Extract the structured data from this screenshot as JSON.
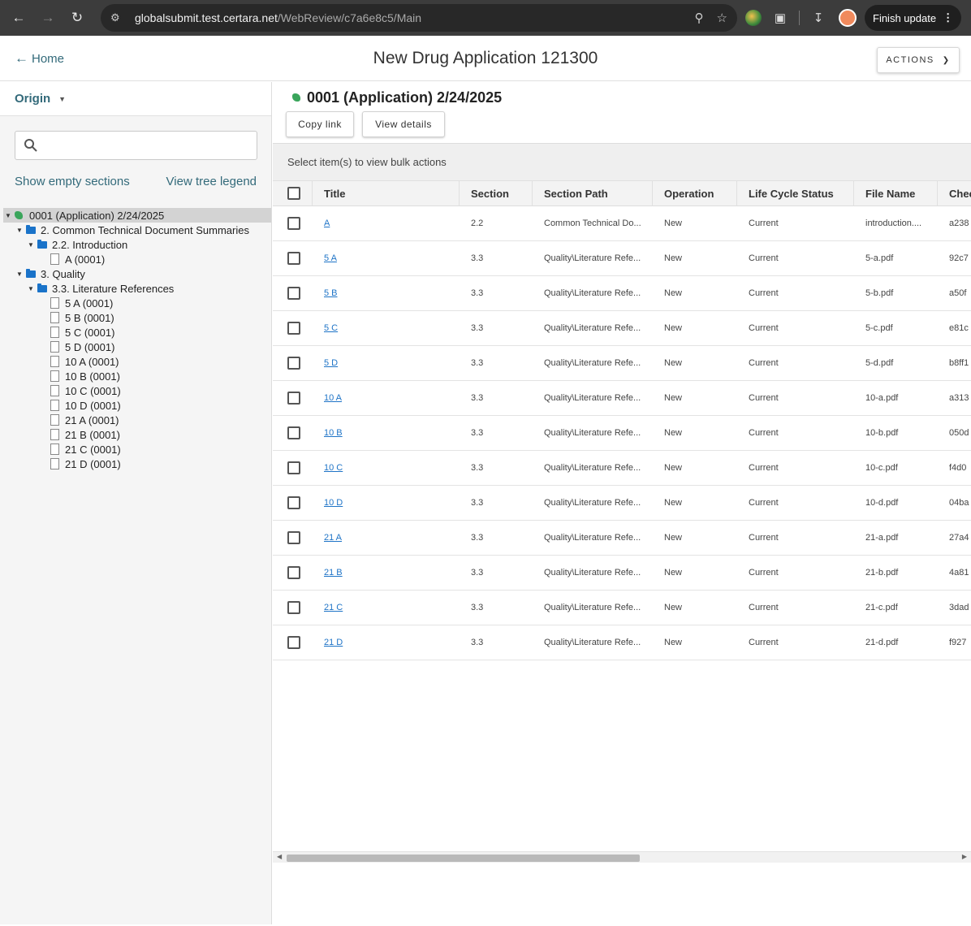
{
  "browser": {
    "url_host": "globalsubmit.test.certara.net",
    "url_path": "/WebReview/c7a6e8c5/Main",
    "finish_update": "Finish update"
  },
  "header": {
    "home": "Home",
    "title": "New Drug Application 121300",
    "actions": "ACTIONS"
  },
  "left": {
    "origin": "Origin",
    "search_placeholder": "",
    "show_empty": "Show empty sections",
    "tree_legend": "View tree legend",
    "tree": [
      {
        "label": "0001 (Application) 2/24/2025"
      },
      {
        "label": "2. Common Technical Document Summaries"
      },
      {
        "label": "2.2. Introduction"
      },
      {
        "label": "A (0001)"
      },
      {
        "label": "3. Quality"
      },
      {
        "label": "3.3. Literature References"
      },
      {
        "label": "5 A (0001)"
      },
      {
        "label": "5 B (0001)"
      },
      {
        "label": "5 C (0001)"
      },
      {
        "label": "5 D (0001)"
      },
      {
        "label": "10 A (0001)"
      },
      {
        "label": "10 B (0001)"
      },
      {
        "label": "10 C (0001)"
      },
      {
        "label": "10 D (0001)"
      },
      {
        "label": "21 A (0001)"
      },
      {
        "label": "21 B (0001)"
      },
      {
        "label": "21 C (0001)"
      },
      {
        "label": "21 D (0001)"
      }
    ]
  },
  "main": {
    "title": "0001 (Application) 2/24/2025",
    "copy_link": "Copy link",
    "view_details": "View details",
    "bulk_text": "Select item(s) to view bulk actions",
    "columns": [
      "Title",
      "Section",
      "Section Path",
      "Operation",
      "Life Cycle Status",
      "File Name",
      "Chec"
    ],
    "rows": [
      [
        "A",
        "2.2",
        "Common Technical Do...",
        "New",
        "Current",
        "introduction....",
        "a238"
      ],
      [
        "5 A",
        "3.3",
        "Quality\\Literature Refe...",
        "New",
        "Current",
        "5-a.pdf",
        "92c7"
      ],
      [
        "5 B",
        "3.3",
        "Quality\\Literature Refe...",
        "New",
        "Current",
        "5-b.pdf",
        "a50f"
      ],
      [
        "5 C",
        "3.3",
        "Quality\\Literature Refe...",
        "New",
        "Current",
        "5-c.pdf",
        "e81c"
      ],
      [
        "5 D",
        "3.3",
        "Quality\\Literature Refe...",
        "New",
        "Current",
        "5-d.pdf",
        "b8ff1"
      ],
      [
        "10 A",
        "3.3",
        "Quality\\Literature Refe...",
        "New",
        "Current",
        "10-a.pdf",
        "a313"
      ],
      [
        "10 B",
        "3.3",
        "Quality\\Literature Refe...",
        "New",
        "Current",
        "10-b.pdf",
        "050d"
      ],
      [
        "10 C",
        "3.3",
        "Quality\\Literature Refe...",
        "New",
        "Current",
        "10-c.pdf",
        "f4d0"
      ],
      [
        "10 D",
        "3.3",
        "Quality\\Literature Refe...",
        "New",
        "Current",
        "10-d.pdf",
        "04ba"
      ],
      [
        "21 A",
        "3.3",
        "Quality\\Literature Refe...",
        "New",
        "Current",
        "21-a.pdf",
        "27a4"
      ],
      [
        "21 B",
        "3.3",
        "Quality\\Literature Refe...",
        "New",
        "Current",
        "21-b.pdf",
        "4a81"
      ],
      [
        "21 C",
        "3.3",
        "Quality\\Literature Refe...",
        "New",
        "Current",
        "21-c.pdf",
        "3dad"
      ],
      [
        "21 D",
        "3.3",
        "Quality\\Literature Refe...",
        "New",
        "Current",
        "21-d.pdf",
        "f927"
      ]
    ]
  }
}
